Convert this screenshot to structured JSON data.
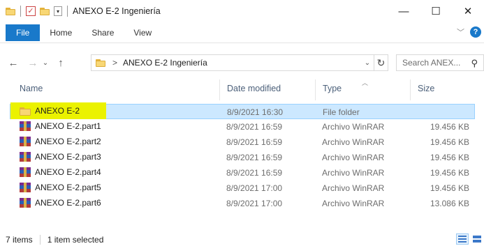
{
  "window": {
    "title": "ANEXO E-2 Ingeniería",
    "minimize": "—",
    "maximize": "☐",
    "close": "✕"
  },
  "ribbon": {
    "tabs": [
      "File",
      "Home",
      "Share",
      "View"
    ],
    "help": "?"
  },
  "navigation": {
    "back": "←",
    "forward": "→",
    "recent": "⌄",
    "up": "↑",
    "breadcrumb_separator": ">",
    "breadcrumb": "ANEXO E-2 Ingeniería",
    "refresh": "↻",
    "search_placeholder": "Search ANEX...",
    "search_icon": "⚲"
  },
  "columns": {
    "name": "Name",
    "date_modified": "Date modified",
    "type": "Type",
    "size": "Size"
  },
  "files": [
    {
      "name": "ANEXO E-2",
      "date": "8/9/2021 16:30",
      "type": "File folder",
      "size": "",
      "icon": "folder-icon",
      "selected": true
    },
    {
      "name": "ANEXO E-2.part1",
      "date": "8/9/2021 16:59",
      "type": "Archivo WinRAR",
      "size": "19.456 KB",
      "icon": "winrar-icon"
    },
    {
      "name": "ANEXO E-2.part2",
      "date": "8/9/2021 16:59",
      "type": "Archivo WinRAR",
      "size": "19.456 KB",
      "icon": "winrar-icon"
    },
    {
      "name": "ANEXO E-2.part3",
      "date": "8/9/2021 16:59",
      "type": "Archivo WinRAR",
      "size": "19.456 KB",
      "icon": "winrar-icon"
    },
    {
      "name": "ANEXO E-2.part4",
      "date": "8/9/2021 16:59",
      "type": "Archivo WinRAR",
      "size": "19.456 KB",
      "icon": "winrar-icon"
    },
    {
      "name": "ANEXO E-2.part5",
      "date": "8/9/2021 17:00",
      "type": "Archivo WinRAR",
      "size": "19.456 KB",
      "icon": "winrar-icon"
    },
    {
      "name": "ANEXO E-2.part6",
      "date": "8/9/2021 17:00",
      "type": "Archivo WinRAR",
      "size": "13.086 KB",
      "icon": "winrar-icon"
    }
  ],
  "status": {
    "item_count": "7 items",
    "selection": "1 item selected"
  },
  "colors": {
    "accent": "#1979ca",
    "selection_bg": "#cce8ff",
    "highlight": "#ebf200"
  }
}
